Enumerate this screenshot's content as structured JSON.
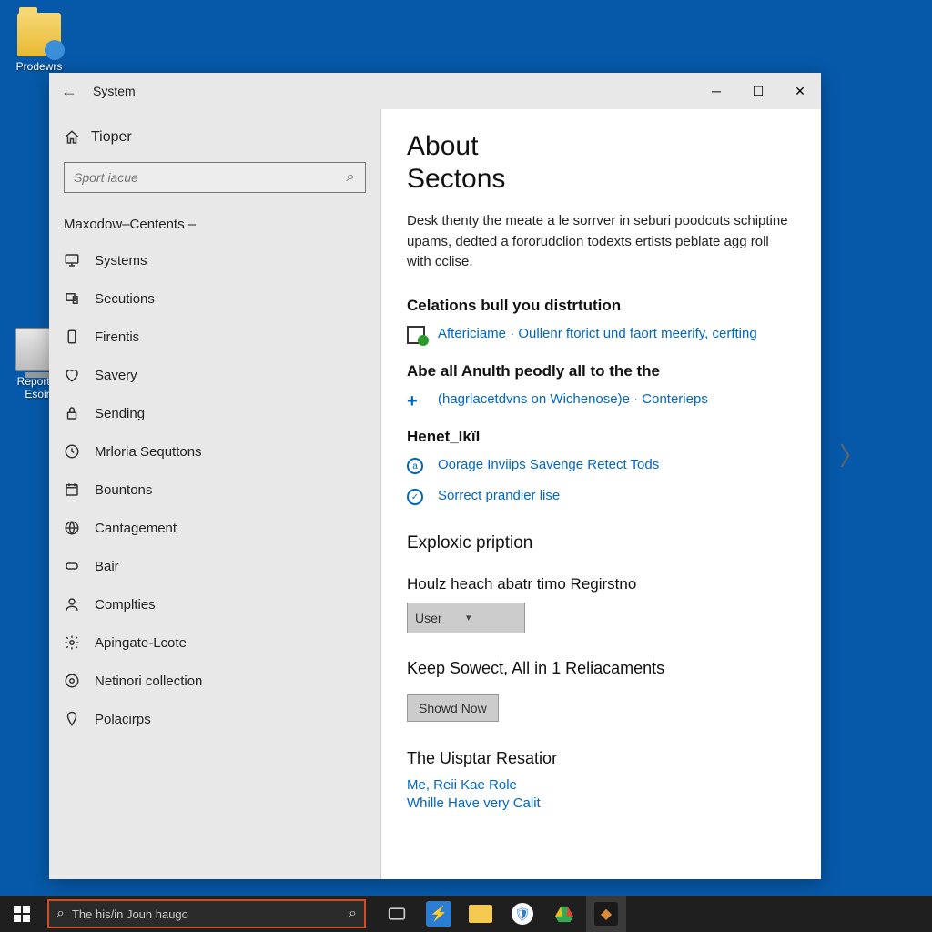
{
  "desktop": {
    "icons": [
      {
        "label": "Prodewrs"
      },
      {
        "label": "Reportis Esoir"
      }
    ]
  },
  "window": {
    "title": "System",
    "sidebar": {
      "home": "Tioper",
      "search_placeholder": "Sport iacue",
      "section_label": "Maxodow–Centents –",
      "items": [
        {
          "label": "Systems"
        },
        {
          "label": "Secutions"
        },
        {
          "label": "Firentis"
        },
        {
          "label": "Savery"
        },
        {
          "label": "Sending"
        },
        {
          "label": "Mrloria Sequttons"
        },
        {
          "label": "Bountons"
        },
        {
          "label": "Cantagement"
        },
        {
          "label": "Bair"
        },
        {
          "label": "Complties"
        },
        {
          "label": "Apingate-Lcote"
        },
        {
          "label": "Netinori collection"
        },
        {
          "label": "Polacirps"
        }
      ]
    },
    "content": {
      "heading1": "About",
      "heading2": "Sectons",
      "description": "Desk thenty the meate a le sorrver in seburi poodcuts schiptine upams, dedted a fororudclion todexts ertists peblate agg roll with cclise.",
      "sec1_title": "Celations bull you distrtution",
      "sec1_link": "Aftericiame · Oullenr ftorict und faort meerify, cerfting",
      "sec2_title": "Abe all Anulth peodly all to the the",
      "sec2_link": "(hagrlacetdvns on Wichenose)e · Conterieps",
      "sec3_title": "Henet_lkïl",
      "sec3_link1": "Oorage Inviips Savenge Retect Tods",
      "sec3_link2": "Sorrect prandier lise",
      "sec4_title": "Exploxic pription",
      "sec5_title": "Houlz heach abatr timo Regirstno",
      "dropdown_value": "User",
      "sec6_title": "Keep Sowect, All in 1 Reliacaments",
      "button_label": "Showd Now",
      "sec7_title": "The Uisptar Resatior",
      "related1": "Me, Reii Kae Role",
      "related2": "Whille Have very Calit"
    }
  },
  "taskbar": {
    "search_value": "The his/in Joun haugo"
  }
}
